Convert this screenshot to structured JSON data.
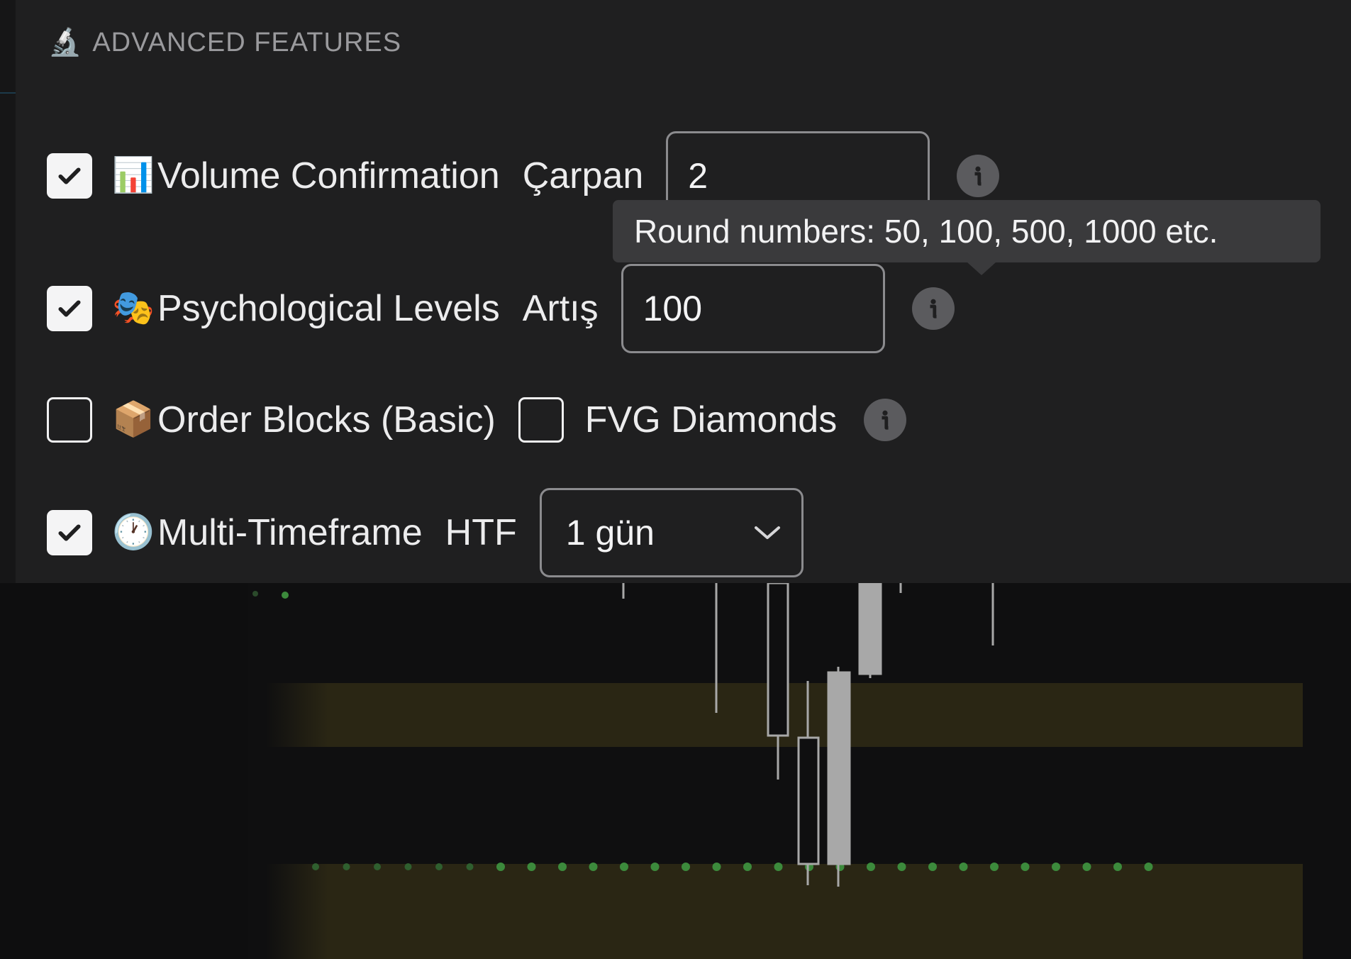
{
  "panel": {
    "header": {
      "icon": "microscope-icon",
      "glyph": "🔬",
      "title": "ADVANCED FEATURES"
    },
    "rows": {
      "volume": {
        "checked": true,
        "emoji": "📊",
        "label": "Volume Confirmation",
        "param_label": "Çarpan",
        "value": "2"
      },
      "psych": {
        "checked": true,
        "emoji": "🎭",
        "label": "Psychological Levels",
        "param_label": "Artış",
        "value": "100"
      },
      "order_blocks": {
        "checked": false,
        "emoji": "📦",
        "label": "Order Blocks (Basic)",
        "fvg_checked": false,
        "fvg_label": "FVG Diamonds"
      },
      "mtf": {
        "checked": true,
        "emoji": "🕐",
        "label": "Multi-Timeframe",
        "param_label": "HTF",
        "selected": "1 gün"
      }
    },
    "tooltip": {
      "text": "Round numbers: 50, 100, 500, 1000 etc."
    }
  },
  "colors": {
    "panel_bg": "#1f1f20",
    "page_bg": "#0e0e0f",
    "zone": "#2a2614",
    "bull_candle": "#a8a8a8",
    "dotted_level": "#3c8a3c"
  }
}
